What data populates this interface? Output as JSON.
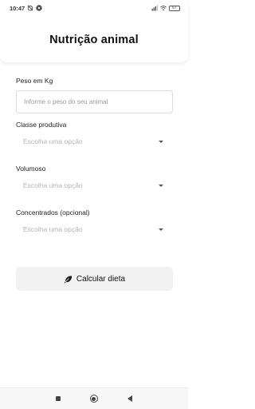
{
  "status_bar": {
    "time": "10:47",
    "battery": "67"
  },
  "header": {
    "title": "Nutrição animal"
  },
  "form": {
    "weight": {
      "label": "Peso em Kg",
      "placeholder": "Informe o peso do seu animal",
      "value": ""
    },
    "productive_class": {
      "label": "Classe produtiva",
      "placeholder": "Escolha uma opção"
    },
    "roughage": {
      "label": "Volumoso",
      "placeholder": "Escolha uma opção"
    },
    "concentrates": {
      "label": "Concentrados (opcional)",
      "placeholder": "Escolha uma opção"
    }
  },
  "actions": {
    "calculate_label": "Calcular dieta",
    "calculate_icon": "leaf-icon"
  },
  "nav_bar": {
    "icons": [
      "recent-apps-icon",
      "home-icon",
      "back-icon"
    ]
  }
}
